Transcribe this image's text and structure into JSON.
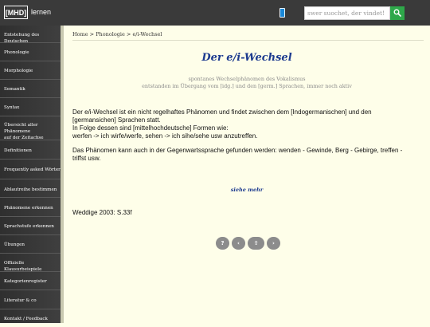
{
  "header": {
    "logo_text": "[MHD]",
    "logo_word": "lernen",
    "search_placeholder": "swer suochet, der vindet!",
    "search_button_icon": "magnifier-icon",
    "mobile_icon": "smartphone-icon"
  },
  "sidebar": {
    "items": [
      {
        "label": "Entstehung des Deutschen"
      },
      {
        "label": "Phonologie"
      },
      {
        "label": "Morphologie"
      },
      {
        "label": "Semantik"
      },
      {
        "label": "Syntax"
      },
      {
        "label_line1": "Übersicht aller Phänomene",
        "label_line2": "auf der Zeitachse"
      },
      {
        "label": "Definitionen"
      },
      {
        "label": "Frequently asked Wörter"
      },
      {
        "label": "Ablautreihe bestimmen"
      },
      {
        "label": "Phänomene erkennen"
      },
      {
        "label": "Sprachstufe erkennen"
      },
      {
        "label": "Übungen"
      },
      {
        "label": "Offizielle Klausurbeispiele"
      },
      {
        "label": "Kategorienregister"
      },
      {
        "label": "Literatur & co"
      },
      {
        "label": "Kontakt / Feedback"
      }
    ]
  },
  "breadcrumb": {
    "home": "Home",
    "sep1": " > ",
    "section": "Phonologie",
    "sep2": " > ",
    "current": "e/i-Wechsel"
  },
  "main": {
    "title": "Der e/i-Wechsel",
    "subtitle_line1": "spontanes Wechselphänomen des Vokalismus",
    "subtitle_line2": "entstanden im Übergang vom [idg.] und den [germ.] Sprachen, immer noch aktiv",
    "para1_line1": "Der e/i-Wechsel ist ein nicht regelhaftes Phänomen und findet zwischen dem [Indogermanischen] und den",
    "para1_line2": "[germansichen] Sprachen statt.",
    "para1_line3": "In Folge dessen sind [mittelhochdeutsche] Formen wie:",
    "para1_line4": "werfen -> ich wirfe/werfe, sehen -> ich sihe/sehe usw anzutreffen.",
    "para2_line1": "Das Phänomen kann auch in der Gegenwartssprache gefunden werden: wenden - Gewinde, Berg - Gebirge, treffen -",
    "para2_line2": "triffst usw.",
    "more_link": "siehe mehr",
    "reference": "Weddige 2003: S.33f"
  },
  "pagination": {
    "help": "?",
    "prev": "‹",
    "up": "⇧",
    "next": "›"
  }
}
